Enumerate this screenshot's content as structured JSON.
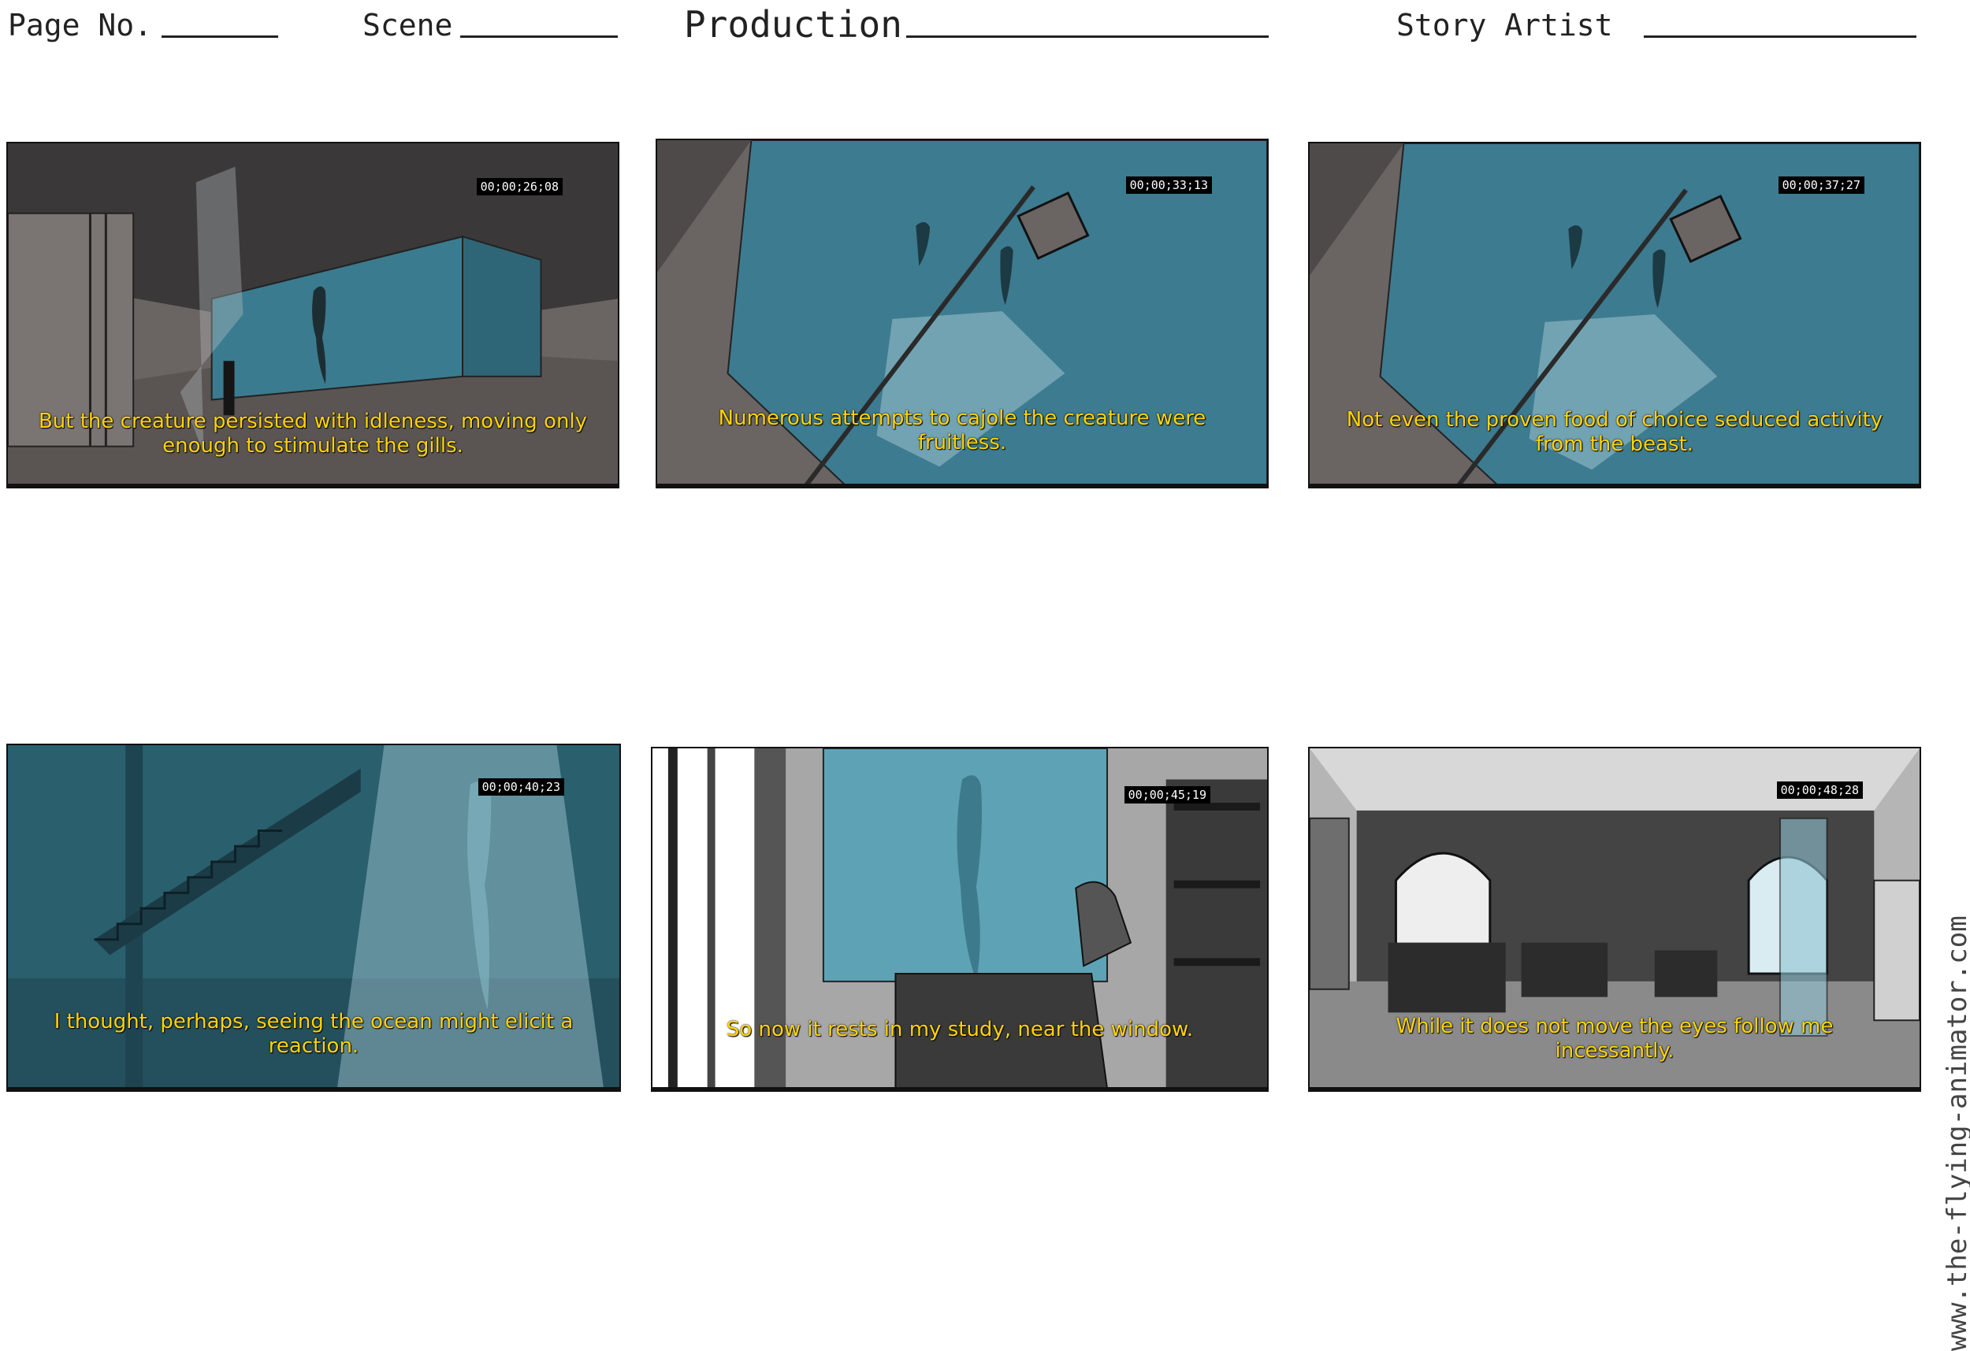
{
  "header": {
    "page_no_label": "Page No.",
    "scene_label": "Scene",
    "production_label": "Production",
    "story_artist_label": "Story Artist"
  },
  "panels": [
    {
      "timecode": "00;00;26;08",
      "caption": "But the creature persisted with idleness, moving only enough to stimulate the gills."
    },
    {
      "timecode": "00;00;33;13",
      "caption": "Numerous attempts to cajole the creature were fruitless."
    },
    {
      "timecode": "00;00;37;27",
      "caption": "Not even the proven food of choice seduced activity from the beast."
    },
    {
      "timecode": "00;00;40;23",
      "caption": "I thought, perhaps, seeing the ocean might elicit a reaction."
    },
    {
      "timecode": "00;00;45;19",
      "caption": "So now it rests in my study, near the window."
    },
    {
      "timecode": "00;00;48;28",
      "caption": "While it does not move the eyes follow me incessantly."
    }
  ],
  "watermark": "www.the-flying-animator.com",
  "colors": {
    "caption": "#ffd400",
    "tank_blue": "#3a7a90",
    "teal_dark": "#2a5f6e",
    "study_blue": "#5ea3b5"
  }
}
